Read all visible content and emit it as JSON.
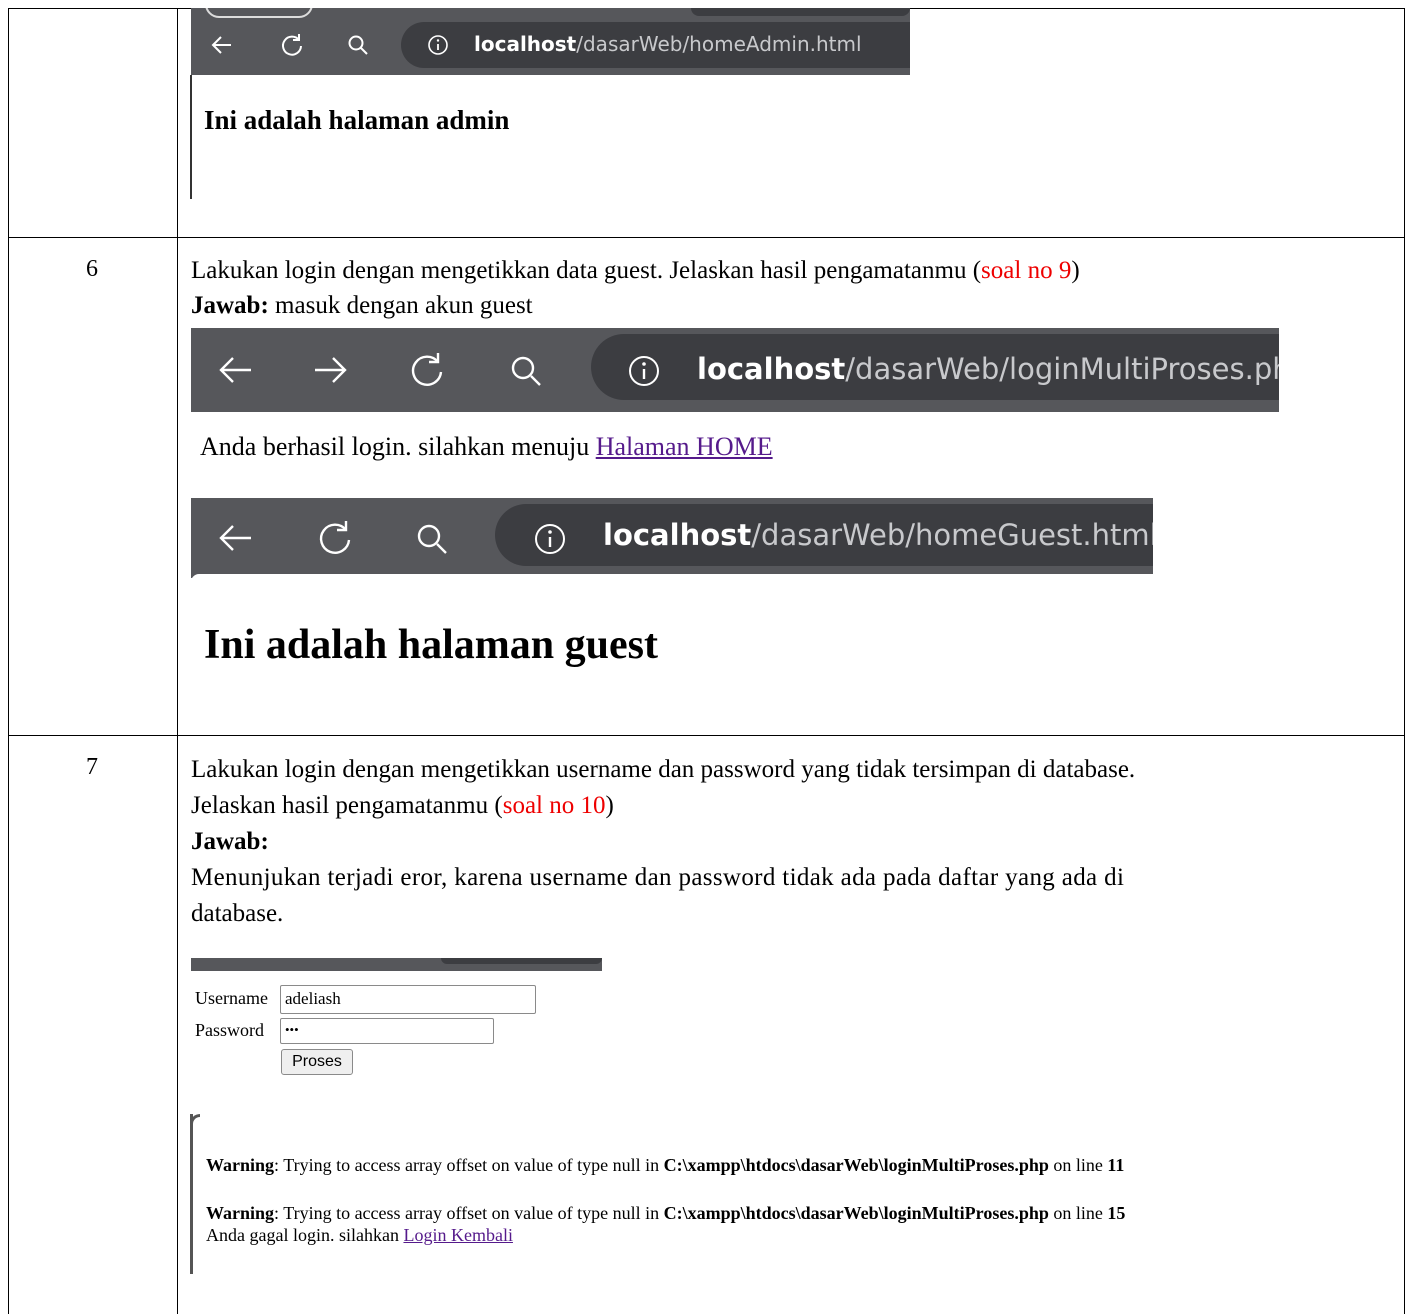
{
  "rows": [
    {
      "number": "",
      "browser": {
        "host": "localhost",
        "path": "/dasarWeb/homeAdmin.html"
      },
      "page_heading": "Ini adalah halaman admin"
    },
    {
      "number": "6",
      "instruction": "Lakukan login dengan mengetikkan data guest. Jelaskan hasil pengamatanmu (",
      "instruction_ref": "soal no 9",
      "instruction_close": ")",
      "answer_label": "Jawab:",
      "answer_text": " masuk dengan akun guest",
      "browser1": {
        "host": "localhost",
        "path": "/dasarWeb/loginMultiProses.php"
      },
      "message": "Anda berhasil login. silahkan menuju ",
      "message_link": "Halaman HOME",
      "browser2": {
        "host": "localhost",
        "path": "/dasarWeb/homeGuest.html"
      },
      "page_heading": "Ini adalah halaman guest"
    },
    {
      "number": "7",
      "instruction_line1": "Lakukan login dengan mengetikkan username dan password yang tidak tersimpan di database.",
      "instruction_line2": "Jelaskan hasil pengamatanmu (",
      "instruction_ref": "soal no 10",
      "instruction_close": ")",
      "answer_label": "Jawab:",
      "answer_line1": "Menunjukan terjadi eror, karena username dan password tidak ada pada daftar yang ada di",
      "answer_line2": "database.",
      "form": {
        "username_label": "Username",
        "username_value": "adeliash",
        "password_label": "Password",
        "password_value": "•••",
        "submit_label": "Proses"
      },
      "warnings": [
        {
          "label": "Warning",
          "text": ": Trying to access array offset on value of type null in ",
          "path": "C:\\xampp\\htdocs\\dasarWeb\\loginMultiProses.php",
          "on_line": " on line ",
          "line": "11"
        },
        {
          "label": "Warning",
          "text": ": Trying to access array offset on value of type null in ",
          "path": "C:\\xampp\\htdocs\\dasarWeb\\loginMultiProses.php",
          "on_line": " on line ",
          "line": "15"
        }
      ],
      "fail_message": "Anda gagal login. silahkan ",
      "fail_link": "Login Kembali"
    }
  ],
  "colors": {
    "bar": "#56575b",
    "pill": "#3c3d41",
    "red": "#ee0000",
    "link": "#551a8b"
  },
  "icons": [
    "back-arrow-icon",
    "forward-arrow-icon",
    "reload-icon",
    "search-icon",
    "info-icon"
  ]
}
